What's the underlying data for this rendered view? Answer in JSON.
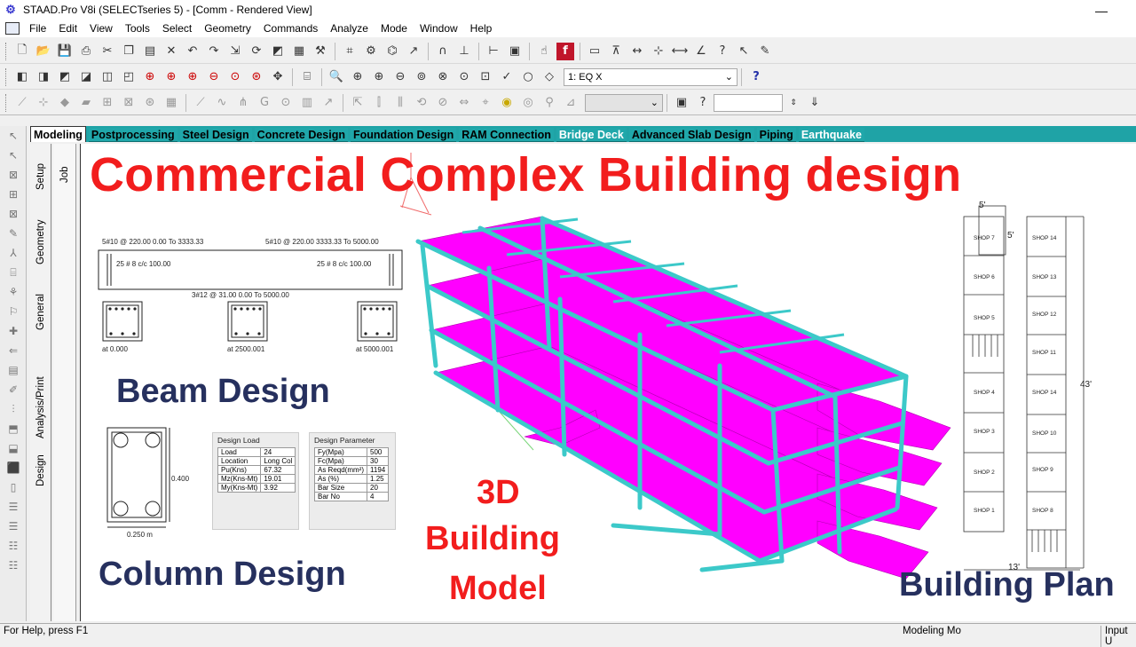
{
  "window": {
    "title": "STAAD.Pro V8i (SELECTseries 5) - [Comm - Rendered View]",
    "minimize": "—"
  },
  "menu": [
    "File",
    "Edit",
    "View",
    "Tools",
    "Select",
    "Geometry",
    "Commands",
    "Analyze",
    "Mode",
    "Window",
    "Help"
  ],
  "toolbar": {
    "load_case": "1: EQ X",
    "input_value": ""
  },
  "tabs": [
    {
      "label": "Modeling",
      "active": true
    },
    {
      "label": "Postprocessing"
    },
    {
      "label": "Steel Design"
    },
    {
      "label": "Concrete Design"
    },
    {
      "label": "Foundation Design"
    },
    {
      "label": "RAM Connection"
    },
    {
      "label": "Bridge Deck",
      "white": true
    },
    {
      "label": "Advanced Slab Design"
    },
    {
      "label": "Piping"
    },
    {
      "label": "Earthquake",
      "white": true
    }
  ],
  "side_tabs": {
    "setup": "Setup",
    "geometry": "Geometry",
    "general": "General",
    "analysis": "Analysis/Print",
    "design": "Design",
    "job": "Job"
  },
  "overlay": {
    "headline": "Commercial Complex Building design",
    "beam_design": "Beam Design",
    "column_design": "Column Design",
    "model_line1": "3D",
    "model_line2": "Building",
    "model_line3": "Model",
    "building_plan": "Building Plan"
  },
  "beam": {
    "top_left": "5#10 @ 220.00 0.00 To 3333.33",
    "top_right": "5#10 @ 220.00 3333.33 To 5000.00",
    "stirrup_left": "25 # 8 c/c 100.00",
    "stirrup_right": "25 # 8 c/c 100.00",
    "bottom": "3#12 @ 31.00 0.00 To 5000.00",
    "sec1": "at 0.000",
    "sec2": "at 2500.001",
    "sec3": "at 5000.001"
  },
  "column": {
    "depth": "0.400",
    "width": "0.250 m"
  },
  "design_load": {
    "title": "Design Load",
    "rows": [
      [
        "Load",
        "24"
      ],
      [
        "Location",
        "Long Col"
      ],
      [
        "Pu(Kns)",
        "67.32"
      ],
      [
        "Mz(Kns-Mt)",
        "19.01"
      ],
      [
        "My(Kns-Mt)",
        "3.92"
      ]
    ]
  },
  "design_parameter": {
    "title": "Design Parameter",
    "rows": [
      [
        "Fy(Mpa)",
        "500"
      ],
      [
        "Fc(Mpa)",
        "30"
      ],
      [
        "As Reqd(mm²)",
        "1194"
      ],
      [
        "As (%)",
        "1.25"
      ],
      [
        "Bar Size",
        "20"
      ],
      [
        "Bar No",
        "4"
      ]
    ]
  },
  "plan": {
    "dim_top": "5'",
    "dim_side": "5'",
    "dim_right": "43'",
    "dim_bottom": "13'",
    "left_shops": [
      "SHOP 7",
      "SHOP 6",
      "SHOP 5",
      "SHOP 4",
      "SHOP 3",
      "SHOP 2",
      "SHOP 1"
    ],
    "right_shops": [
      "SHOP 14",
      "SHOP 13",
      "SHOP 12",
      "SHOP 11",
      "SHOP 14",
      "SHOP 10",
      "SHOP 9",
      "SHOP 8"
    ]
  },
  "status": {
    "help": "For Help, press F1",
    "mode": "Modeling Mo",
    "input": "Input U"
  },
  "colors": {
    "tab_bar": "#1fa3a6",
    "headline": "#f21d1d",
    "labels": "#26305e",
    "slab": "#ff00ff",
    "frame": "#3cc9c9"
  }
}
